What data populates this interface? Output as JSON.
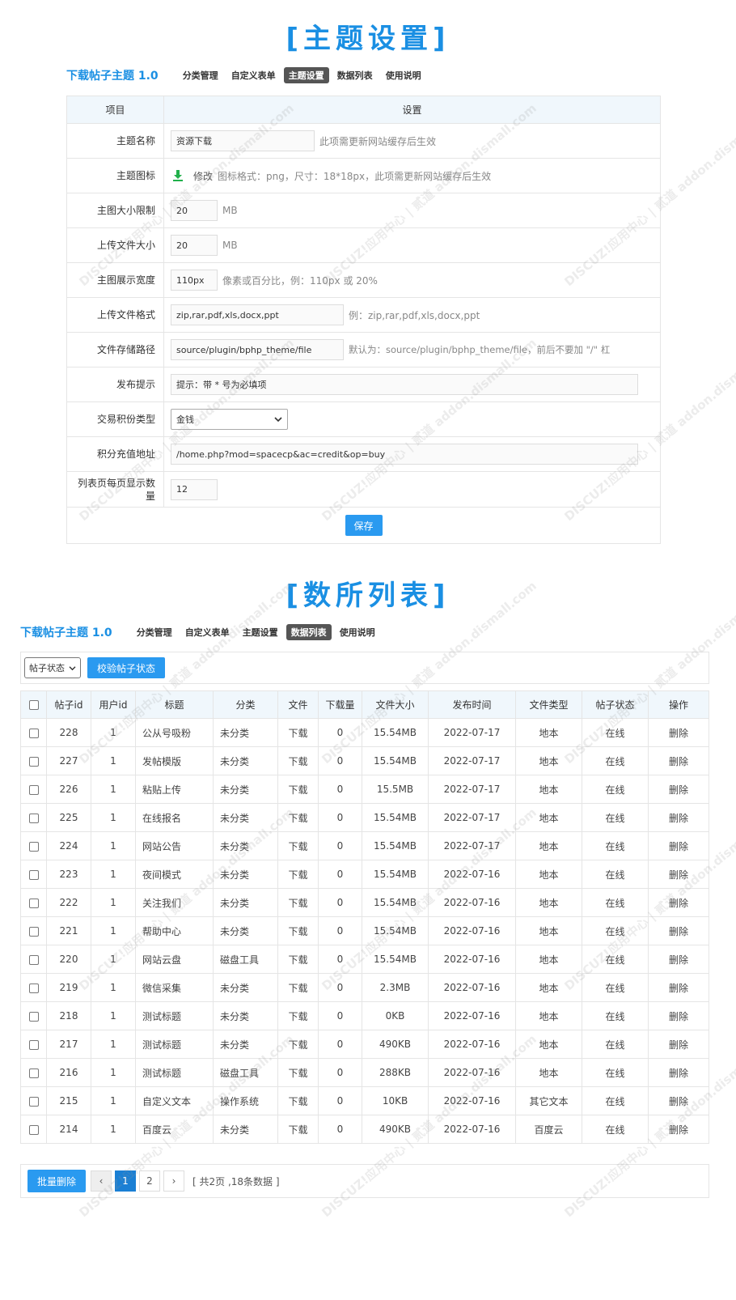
{
  "section1_title": "[主题设置]",
  "section2_title": "[数所列表]",
  "plugin_name": "下载帖子主题 1.0",
  "nav": [
    "分类管理",
    "自定义表单",
    "主题设置",
    "数据列表",
    "使用说明"
  ],
  "settings": {
    "header": {
      "item": "项目",
      "setting": "设置"
    },
    "rows": {
      "theme_name": {
        "label": "主题名称",
        "value": "资源下载",
        "hint": "此项需更新网站缓存后生效"
      },
      "theme_icon": {
        "label": "主题图标",
        "action": "修改",
        "hint": "图标格式：png，尺寸：18*18px，此项需更新网站缓存后生效",
        "icon": "download-arrow-icon",
        "icon_color": "#21b04b"
      },
      "image_limit": {
        "label": "主图大小限制",
        "value": "20",
        "unit": "MB"
      },
      "upload_size": {
        "label": "上传文件大小",
        "value": "20",
        "unit": "MB"
      },
      "image_width": {
        "label": "主图展示宽度",
        "value": "110px",
        "hint": "像素或百分比，例：110px 或 20%"
      },
      "upload_format": {
        "label": "上传文件格式",
        "value": "zip,rar,pdf,xls,docx,ppt",
        "hint": "例：zip,rar,pdf,xls,docx,ppt"
      },
      "storage_path": {
        "label": "文件存储路径",
        "value": "source/plugin/bphp_theme/file",
        "hint": "默认为：source/plugin/bphp_theme/file，前后不要加 \"/\" 杠"
      },
      "publish_tip": {
        "label": "发布提示",
        "value": "提示：带 * 号为必填项"
      },
      "credit_type": {
        "label": "交易积份类型",
        "value": "金钱"
      },
      "recharge_url": {
        "label": "积分充值地址",
        "value": "/home.php?mod=spacecp&ac=credit&op=buy"
      },
      "per_page": {
        "label": "列表页每页显示数量",
        "value": "12"
      }
    },
    "save_label": "保存"
  },
  "list": {
    "filter_value": "帖子状态",
    "verify_button": "校验帖子状态",
    "columns": [
      "帖子id",
      "用户id",
      "标题",
      "分类",
      "文件",
      "下载量",
      "文件大小",
      "发布时间",
      "文件类型",
      "帖子状态",
      "操作"
    ],
    "rows": [
      {
        "id": "228",
        "uid": "1",
        "title": "公从号吸粉",
        "cat": "未分类",
        "file": "下载",
        "dl": "0",
        "size": "15.54MB",
        "date": "2022-07-17",
        "type": "地本",
        "status": "在线",
        "op": "删除"
      },
      {
        "id": "227",
        "uid": "1",
        "title": "发帖模版",
        "cat": "未分类",
        "file": "下载",
        "dl": "0",
        "size": "15.54MB",
        "date": "2022-07-17",
        "type": "地本",
        "status": "在线",
        "op": "删除"
      },
      {
        "id": "226",
        "uid": "1",
        "title": "粘贴上传",
        "cat": "未分类",
        "file": "下载",
        "dl": "0",
        "size": "15.5MB",
        "date": "2022-07-17",
        "type": "地本",
        "status": "在线",
        "op": "删除"
      },
      {
        "id": "225",
        "uid": "1",
        "title": "在线报名",
        "cat": "未分类",
        "file": "下载",
        "dl": "0",
        "size": "15.54MB",
        "date": "2022-07-17",
        "type": "地本",
        "status": "在线",
        "op": "删除"
      },
      {
        "id": "224",
        "uid": "1",
        "title": "网站公告",
        "cat": "未分类",
        "file": "下载",
        "dl": "0",
        "size": "15.54MB",
        "date": "2022-07-17",
        "type": "地本",
        "status": "在线",
        "op": "删除"
      },
      {
        "id": "223",
        "uid": "1",
        "title": "夜间模式",
        "cat": "未分类",
        "file": "下载",
        "dl": "0",
        "size": "15.54MB",
        "date": "2022-07-16",
        "type": "地本",
        "status": "在线",
        "op": "删除"
      },
      {
        "id": "222",
        "uid": "1",
        "title": "关注我们",
        "cat": "未分类",
        "file": "下载",
        "dl": "0",
        "size": "15.54MB",
        "date": "2022-07-16",
        "type": "地本",
        "status": "在线",
        "op": "删除"
      },
      {
        "id": "221",
        "uid": "1",
        "title": "帮助中心",
        "cat": "未分类",
        "file": "下载",
        "dl": "0",
        "size": "15.54MB",
        "date": "2022-07-16",
        "type": "地本",
        "status": "在线",
        "op": "删除"
      },
      {
        "id": "220",
        "uid": "1",
        "title": "网站云盘",
        "cat": "磁盘工具",
        "file": "下载",
        "dl": "0",
        "size": "15.54MB",
        "date": "2022-07-16",
        "type": "地本",
        "status": "在线",
        "op": "删除"
      },
      {
        "id": "219",
        "uid": "1",
        "title": "微信采集",
        "cat": "未分类",
        "file": "下载",
        "dl": "0",
        "size": "2.3MB",
        "date": "2022-07-16",
        "type": "地本",
        "status": "在线",
        "op": "删除"
      },
      {
        "id": "218",
        "uid": "1",
        "title": "测试标题",
        "cat": "未分类",
        "file": "下载",
        "dl": "0",
        "size": "0KB",
        "date": "2022-07-16",
        "type": "地本",
        "status": "在线",
        "op": "删除"
      },
      {
        "id": "217",
        "uid": "1",
        "title": "测试标题",
        "cat": "未分类",
        "file": "下载",
        "dl": "0",
        "size": "490KB",
        "date": "2022-07-16",
        "type": "地本",
        "status": "在线",
        "op": "删除"
      },
      {
        "id": "216",
        "uid": "1",
        "title": "测试标题",
        "cat": "磁盘工具",
        "file": "下载",
        "dl": "0",
        "size": "288KB",
        "date": "2022-07-16",
        "type": "地本",
        "status": "在线",
        "op": "删除"
      },
      {
        "id": "215",
        "uid": "1",
        "title": "自定义文本",
        "cat": "操作系统",
        "file": "下载",
        "dl": "0",
        "size": "10KB",
        "date": "2022-07-16",
        "type": "其它文本",
        "status": "在线",
        "op": "删除"
      },
      {
        "id": "214",
        "uid": "1",
        "title": "百度云",
        "cat": "未分类",
        "file": "下载",
        "dl": "0",
        "size": "490KB",
        "date": "2022-07-16",
        "type": "百度云",
        "status": "在线",
        "op": "删除"
      }
    ],
    "batch_delete": "批量删除",
    "pages": [
      "1",
      "2"
    ],
    "current_page": "1",
    "page_info": "[ 共2页 ,18条数据 ]"
  },
  "watermark": "DISCUZ!应用中心 | 贰道 addon.dismall.com",
  "colors": {
    "accent": "#1a8fe3",
    "uncategorized": "#ff4a4a",
    "status": "#2a9af0",
    "button": "#2a9af0"
  }
}
